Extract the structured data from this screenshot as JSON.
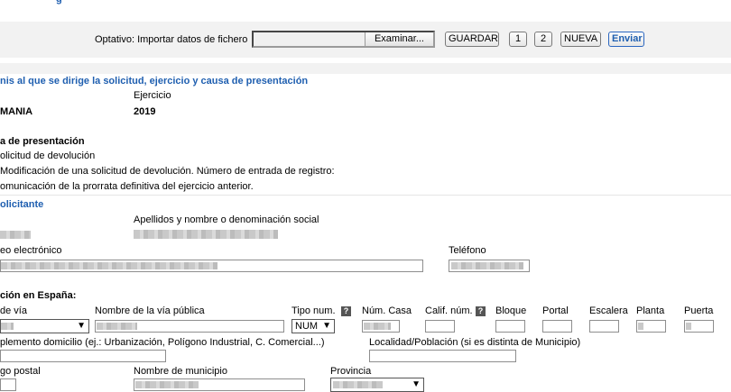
{
  "top_link": "g",
  "import_bar": {
    "label": "Optativo: Importar datos de fichero",
    "browse_label": "Examinar...",
    "save_label": "GUARDAR",
    "page1_label": "1",
    "page2_label": "2",
    "new_label": "NUEVA",
    "send_label": "Enviar"
  },
  "section_country": {
    "title": "nis al que se dirige la solicitud, ejercicio y causa de presentación",
    "ejercicio_label": "Ejercicio",
    "country_value": "MANIA",
    "ejercicio_value": "2019",
    "causa_title": "a de presentación",
    "options": [
      "olicitud de devolución",
      "Modificación de una solicitud de devolución. Número de entrada de registro:",
      "omunicación de la prorrata definitiva del ejercicio anterior."
    ]
  },
  "section_applicant": {
    "title": "olicitante",
    "name_label": "Apellidos y nombre o denominación social",
    "email_label": "eo electrónico",
    "phone_label": "Teléfono"
  },
  "section_address": {
    "title": "ción en España:",
    "labels": {
      "via_type": " de vía",
      "via_name": "Nombre de la vía pública",
      "num_type": "Tipo num.",
      "house_num": "Núm. Casa",
      "calif_num": "Calif. núm.",
      "bloque": "Bloque",
      "portal": "Portal",
      "escalera": "Escalera",
      "planta": "Planta",
      "puerta": "Puerta",
      "complemento": "plemento domicilio (ej.: Urbanización, Polígono Industrial, C. Comercial...)",
      "localidad": "Localidad/Población (si es distinta de Municipio)",
      "postal": "go postal",
      "municipio": "Nombre de municipio",
      "provincia": "Provincia"
    },
    "num_type_value": "NUM",
    "help_glyph": "?"
  }
}
